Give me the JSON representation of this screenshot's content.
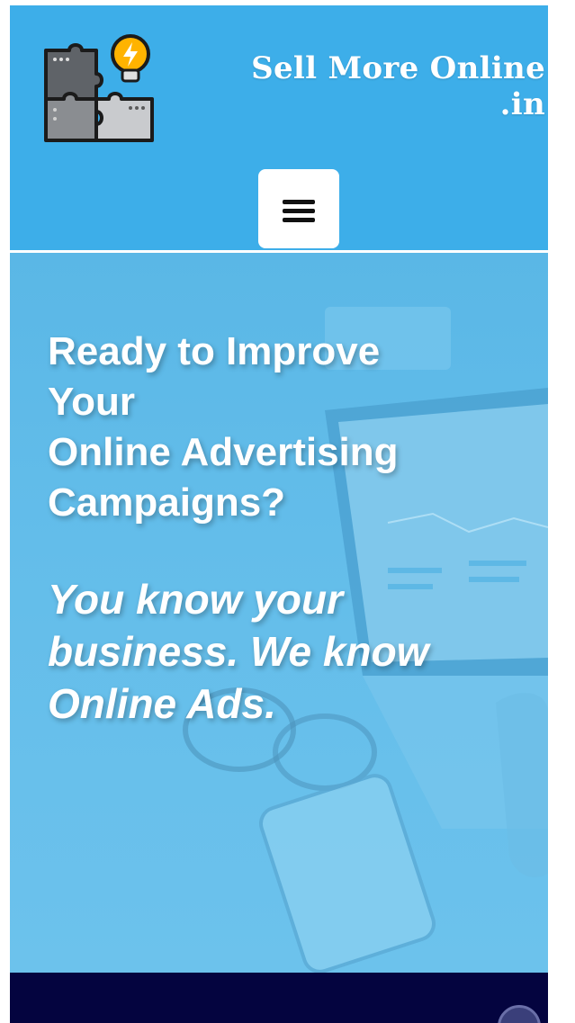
{
  "header": {
    "brand_line1": "Sell More Online",
    "brand_line2": ".in",
    "logo_icon": "puzzle-lightbulb-icon",
    "menu_icon": "hamburger-menu-icon",
    "background_color": "#3daee9"
  },
  "hero": {
    "heading_lines": [
      "Ready to Improve",
      "Your",
      "Online Advertising",
      "Campaigns?"
    ],
    "tagline_line1": "You know your",
    "tagline_line2": "business. We know",
    "tagline_line3": "Online Ads.",
    "background_image": "laptop-desk-photo"
  },
  "footer_band": {
    "background_color": "#04043f"
  }
}
